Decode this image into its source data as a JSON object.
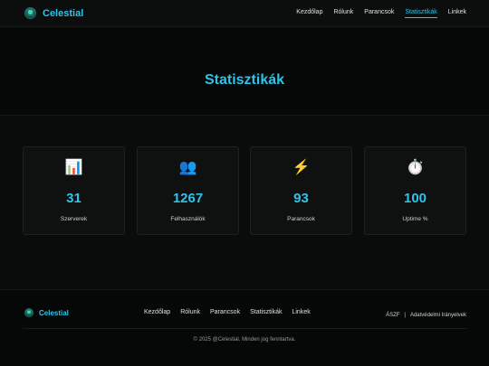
{
  "header": {
    "brand": "Celestial",
    "nav": [
      {
        "label": "Kezdőlap"
      },
      {
        "label": "Rólunk"
      },
      {
        "label": "Parancsok"
      },
      {
        "label": "Statisztikák"
      },
      {
        "label": "Linkek"
      }
    ],
    "active_nav": "Statisztikák"
  },
  "hero": {
    "title": "Statisztikák"
  },
  "stats": [
    {
      "icon": "📊",
      "icon_name": "bar-chart-icon",
      "value": "31",
      "label": "Szerverek"
    },
    {
      "icon": "👥",
      "icon_name": "users-icon",
      "value": "1267",
      "label": "Felhasználók"
    },
    {
      "icon": "⚡",
      "icon_name": "lightning-icon",
      "value": "93",
      "label": "Parancsok"
    },
    {
      "icon": "⏱️",
      "icon_name": "stopwatch-icon",
      "value": "100",
      "label": "Uptime %"
    }
  ],
  "footer": {
    "brand": "Celestial",
    "nav": [
      {
        "label": "Kezdőlap"
      },
      {
        "label": "Rólunk"
      },
      {
        "label": "Parancsok"
      },
      {
        "label": "Statisztikák"
      },
      {
        "label": "Linkek"
      }
    ],
    "legal": {
      "terms": "ÁSZF",
      "separator": "|",
      "privacy": "Adatvédelmi Irányelvek"
    },
    "copyright": "© 2025 @Celestial. Minden jog fenntartva."
  },
  "colors": {
    "accent": "#2ec4ea",
    "background": "#0a0b0b",
    "card": "#0f1111"
  }
}
